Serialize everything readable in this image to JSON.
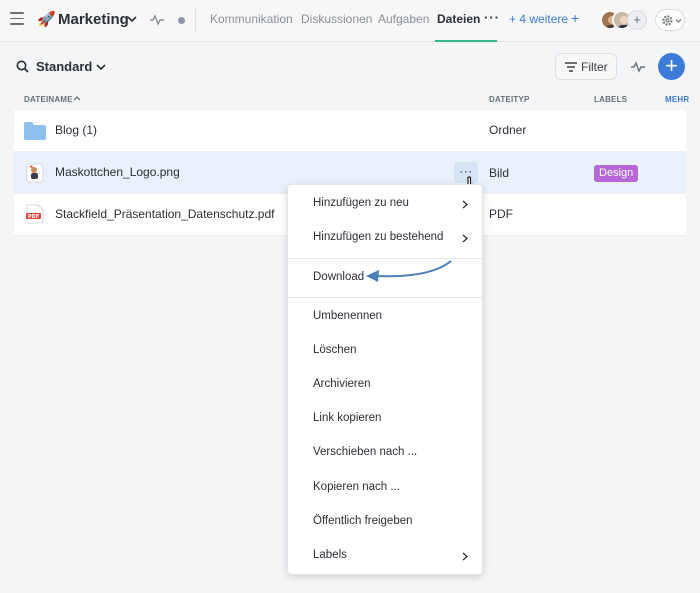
{
  "header": {
    "room_title": "Marketing",
    "tabs": [
      {
        "label": "Kommunikation",
        "active": false
      },
      {
        "label": "Diskussionen",
        "active": false
      },
      {
        "label": "Aufgaben",
        "active": false
      },
      {
        "label": "Dateien",
        "active": true
      }
    ],
    "more_tabs_label": "+ 4 weitere",
    "add_tab_label": "+",
    "accent_color": "#3ab58a"
  },
  "toolbar": {
    "view_label": "Standard",
    "filter_label": "Filter",
    "add_label": "+"
  },
  "table": {
    "columns": [
      "Dateiname",
      "Dateityp",
      "Labels",
      "Mehr"
    ],
    "rows": [
      {
        "name": "Blog (1)",
        "type": "Ordner",
        "label": "",
        "icon": "folder-icon"
      },
      {
        "name": "Maskottchen_Logo.png",
        "type": "Bild",
        "label": "Design",
        "icon": "image-file-icon"
      },
      {
        "name": "Stackfield_Präsentation_Datenschutz.pdf",
        "type": "PDF",
        "label": "",
        "icon": "pdf-file-icon"
      }
    ],
    "label_color": "#b768d6"
  },
  "context_menu": {
    "items": [
      {
        "label": "Hinzufügen zu neu",
        "submenu": true
      },
      {
        "label": "Hinzufügen zu bestehend",
        "submenu": true
      },
      {
        "label": "Download",
        "submenu": false
      },
      {
        "label": "Umbenennen",
        "submenu": false
      },
      {
        "label": "Löschen",
        "submenu": false
      },
      {
        "label": "Archivieren",
        "submenu": false
      },
      {
        "label": "Link kopieren",
        "submenu": false
      },
      {
        "label": "Verschieben nach ...",
        "submenu": false
      },
      {
        "label": "Kopieren nach ...",
        "submenu": false
      },
      {
        "label": "Öffentlich freigeben",
        "submenu": false
      },
      {
        "label": "Labels",
        "submenu": true
      }
    ]
  }
}
